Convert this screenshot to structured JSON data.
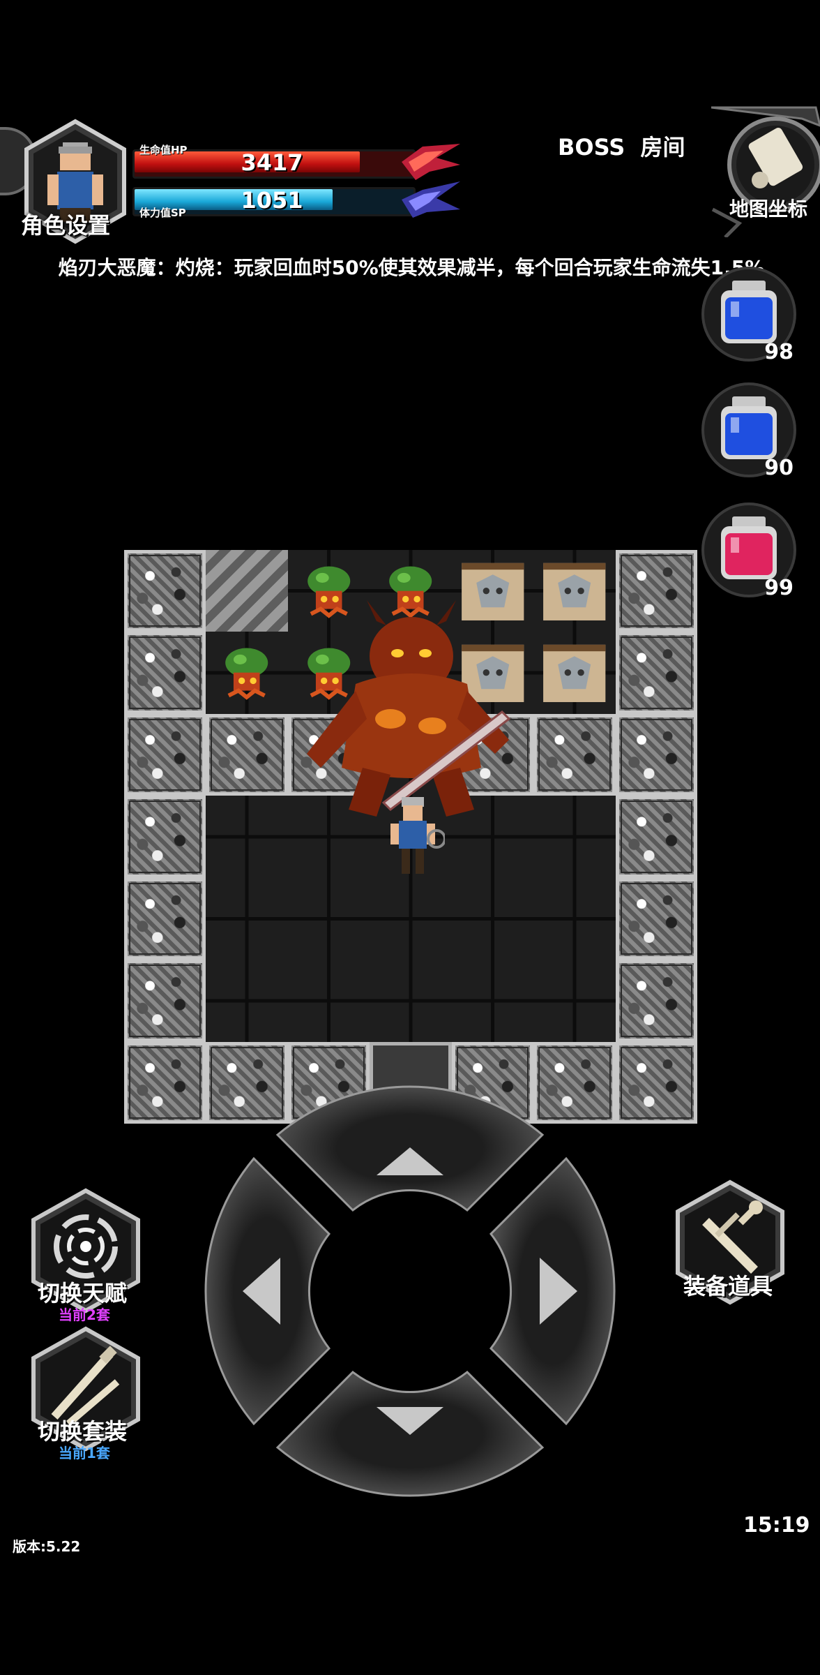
{
  "hud": {
    "character_settings_label": "角色设置",
    "hp": {
      "label": "生命值HP",
      "value": "3417",
      "fill_fraction": 0.82
    },
    "sp": {
      "label": "体力值SP",
      "value": "1051",
      "fill_fraction": 0.72
    },
    "room_label": "BOSS  房间",
    "map_button_label": "地图坐标",
    "boss_description": "焰刃大恶魔：灼烧：玩家回血时50%使其效果减半，每个回合玩家生命流失1.5%"
  },
  "potions": [
    {
      "name": "blue-potion",
      "count": "98",
      "color": "#1f4fe0"
    },
    {
      "name": "blue-potion",
      "count": "90",
      "color": "#1f4fe0"
    },
    {
      "name": "red-potion",
      "count": "99",
      "color": "#e0245f"
    }
  ],
  "dungeon": {
    "rows": [
      [
        "wall",
        "stairs",
        "floor",
        "floor",
        "floor",
        "floor",
        "wall"
      ],
      [
        "wall",
        "floor",
        "floor",
        "floor",
        "floor",
        "floor",
        "wall"
      ],
      [
        "wall",
        "wall",
        "wall",
        "floor",
        "wall",
        "wall",
        "wall"
      ],
      [
        "wall",
        "floor",
        "floor",
        "floor",
        "floor",
        "floor",
        "wall"
      ],
      [
        "wall",
        "floor",
        "floor",
        "floor",
        "floor",
        "floor",
        "wall"
      ],
      [
        "wall",
        "floor",
        "floor",
        "floor",
        "floor",
        "floor",
        "wall"
      ],
      [
        "wall",
        "wall",
        "wall",
        "gate",
        "wall",
        "wall",
        "wall"
      ]
    ],
    "sprites": [
      {
        "name": "fire-plant-enemy",
        "row": 0,
        "col": 2
      },
      {
        "name": "fire-plant-enemy",
        "row": 0,
        "col": 3
      },
      {
        "name": "fire-plant-enemy",
        "row": 1,
        "col": 1
      },
      {
        "name": "fire-plant-enemy",
        "row": 1,
        "col": 2
      },
      {
        "name": "wolf-banner",
        "row": 0,
        "col": 4
      },
      {
        "name": "wolf-banner",
        "row": 0,
        "col": 5
      },
      {
        "name": "wolf-banner",
        "row": 1,
        "col": 4
      },
      {
        "name": "wolf-banner",
        "row": 1,
        "col": 5
      }
    ]
  },
  "controls": {
    "switch_talent_label": "切换天赋",
    "switch_talent_sub": "当前2套",
    "switch_outfit_label": "切换套装",
    "switch_outfit_sub": "当前1套",
    "equip_items_label": "装备道具"
  },
  "footer": {
    "version": "版本:5.22",
    "clock": "15:19"
  },
  "colors": {
    "talent_sub": "#e040ff",
    "outfit_sub": "#4aa8ff"
  }
}
